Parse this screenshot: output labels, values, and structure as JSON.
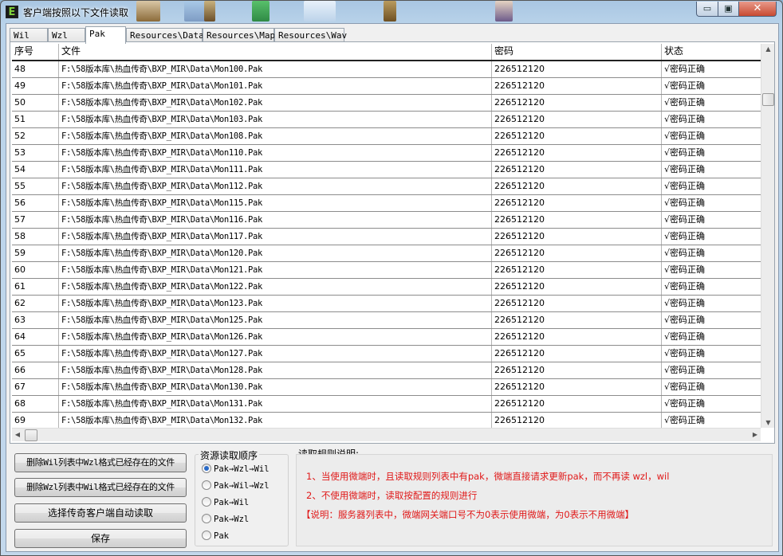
{
  "window": {
    "title": "客户端按照以下文件读取",
    "icon_letter": "E",
    "close_glyph": "✕",
    "min_glyph": "▭",
    "max_glyph": "▣"
  },
  "tabs": [
    {
      "label": "Wil"
    },
    {
      "label": "Wzl"
    },
    {
      "label": "Pak",
      "active": true
    },
    {
      "label": "Resources\\Data"
    },
    {
      "label": "Resources\\Map"
    },
    {
      "label": "Resources\\Wav"
    }
  ],
  "table": {
    "headers": [
      "序号",
      "文件",
      "密码",
      "状态"
    ],
    "rows": [
      [
        "48",
        "F:\\58版本库\\热血传奇\\BXP_MIR\\Data\\Mon100.Pak",
        "226512120",
        "√密码正确"
      ],
      [
        "49",
        "F:\\58版本库\\热血传奇\\BXP_MIR\\Data\\Mon101.Pak",
        "226512120",
        "√密码正确"
      ],
      [
        "50",
        "F:\\58版本库\\热血传奇\\BXP_MIR\\Data\\Mon102.Pak",
        "226512120",
        "√密码正确"
      ],
      [
        "51",
        "F:\\58版本库\\热血传奇\\BXP_MIR\\Data\\Mon103.Pak",
        "226512120",
        "√密码正确"
      ],
      [
        "52",
        "F:\\58版本库\\热血传奇\\BXP_MIR\\Data\\Mon108.Pak",
        "226512120",
        "√密码正确"
      ],
      [
        "53",
        "F:\\58版本库\\热血传奇\\BXP_MIR\\Data\\Mon110.Pak",
        "226512120",
        "√密码正确"
      ],
      [
        "54",
        "F:\\58版本库\\热血传奇\\BXP_MIR\\Data\\Mon111.Pak",
        "226512120",
        "√密码正确"
      ],
      [
        "55",
        "F:\\58版本库\\热血传奇\\BXP_MIR\\Data\\Mon112.Pak",
        "226512120",
        "√密码正确"
      ],
      [
        "56",
        "F:\\58版本库\\热血传奇\\BXP_MIR\\Data\\Mon115.Pak",
        "226512120",
        "√密码正确"
      ],
      [
        "57",
        "F:\\58版本库\\热血传奇\\BXP_MIR\\Data\\Mon116.Pak",
        "226512120",
        "√密码正确"
      ],
      [
        "58",
        "F:\\58版本库\\热血传奇\\BXP_MIR\\Data\\Mon117.Pak",
        "226512120",
        "√密码正确"
      ],
      [
        "59",
        "F:\\58版本库\\热血传奇\\BXP_MIR\\Data\\Mon120.Pak",
        "226512120",
        "√密码正确"
      ],
      [
        "60",
        "F:\\58版本库\\热血传奇\\BXP_MIR\\Data\\Mon121.Pak",
        "226512120",
        "√密码正确"
      ],
      [
        "61",
        "F:\\58版本库\\热血传奇\\BXP_MIR\\Data\\Mon122.Pak",
        "226512120",
        "√密码正确"
      ],
      [
        "62",
        "F:\\58版本库\\热血传奇\\BXP_MIR\\Data\\Mon123.Pak",
        "226512120",
        "√密码正确"
      ],
      [
        "63",
        "F:\\58版本库\\热血传奇\\BXP_MIR\\Data\\Mon125.Pak",
        "226512120",
        "√密码正确"
      ],
      [
        "64",
        "F:\\58版本库\\热血传奇\\BXP_MIR\\Data\\Mon126.Pak",
        "226512120",
        "√密码正确"
      ],
      [
        "65",
        "F:\\58版本库\\热血传奇\\BXP_MIR\\Data\\Mon127.Pak",
        "226512120",
        "√密码正确"
      ],
      [
        "66",
        "F:\\58版本库\\热血传奇\\BXP_MIR\\Data\\Mon128.Pak",
        "226512120",
        "√密码正确"
      ],
      [
        "67",
        "F:\\58版本库\\热血传奇\\BXP_MIR\\Data\\Mon130.Pak",
        "226512120",
        "√密码正确"
      ],
      [
        "68",
        "F:\\58版本库\\热血传奇\\BXP_MIR\\Data\\Mon131.Pak",
        "226512120",
        "√密码正确"
      ],
      [
        "69",
        "F:\\58版本库\\热血传奇\\BXP_MIR\\Data\\Mon132.Pak",
        "226512120",
        "√密码正确"
      ]
    ]
  },
  "buttons": {
    "delete_wil": "删除Wil列表中Wzl格式已经存在的文件",
    "delete_wzl": "删除Wzl列表中Wil格式已经存在的文件",
    "auto_read": "选择传奇客户端自动读取",
    "save": "保存"
  },
  "order_group": {
    "title": "资源读取顺序",
    "options": [
      {
        "label": "Pak→Wzl→Wil",
        "selected": true
      },
      {
        "label": "Pak→Wil→Wzl",
        "selected": false
      },
      {
        "label": "Pak→Wil",
        "selected": false
      },
      {
        "label": "Pak→Wzl",
        "selected": false
      },
      {
        "label": "Pak",
        "selected": false
      }
    ]
  },
  "rules": {
    "title": "读取规则说明:",
    "line1": "1、当使用微端时，且读取规则列表中有pak，微端直接请求更新pak，而不再读 wzl，wil",
    "line2": "2、不使用微端时，读取按配置的规则进行",
    "line3": "【说明：服务器列表中，微端网关端口号不为0表示使用微端，为0表示不用微端】",
    "color": "#e01818"
  }
}
